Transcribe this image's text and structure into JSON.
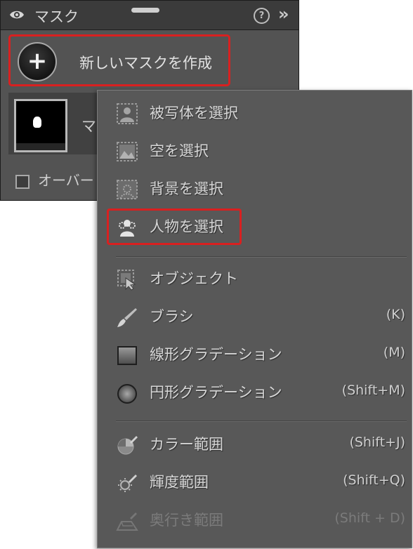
{
  "panel": {
    "title": "マスク",
    "header_icons": [
      "eye-icon",
      "grip-handle",
      "help-icon",
      "chevron-double-right-icon"
    ],
    "new_mask_label": "新しいマスクを作成",
    "new_mask_button_glyph": "+",
    "mask_item_name": "マ",
    "overlay_label": "オーバー",
    "help_glyph": "?",
    "chevron_glyph": "»"
  },
  "menu": {
    "items": [
      {
        "label": "被写体を選択",
        "shortcut": "",
        "icon": "select-subject-icon",
        "enabled": true
      },
      {
        "label": "空を選択",
        "shortcut": "",
        "icon": "select-sky-icon",
        "enabled": true
      },
      {
        "label": "背景を選択",
        "shortcut": "",
        "icon": "select-background-icon",
        "enabled": true
      },
      {
        "label": "人物を選択",
        "shortcut": "",
        "icon": "select-people-icon",
        "enabled": true
      },
      {
        "label": "オブジェクト",
        "shortcut": "",
        "icon": "object-select-icon",
        "enabled": true
      },
      {
        "label": "ブラシ",
        "shortcut": "(K)",
        "icon": "brush-icon",
        "enabled": true
      },
      {
        "label": "線形グラデーション",
        "shortcut": "(M)",
        "icon": "linear-gradient-icon",
        "enabled": true
      },
      {
        "label": "円形グラデーション",
        "shortcut": "(Shift+M)",
        "icon": "radial-gradient-icon",
        "enabled": true
      },
      {
        "label": "カラー範囲",
        "shortcut": "(Shift+J)",
        "icon": "color-range-icon",
        "enabled": true
      },
      {
        "label": "輝度範囲",
        "shortcut": "(Shift+Q)",
        "icon": "luminance-range-icon",
        "enabled": true
      },
      {
        "label": "奥行き範囲",
        "shortcut": "(Shift + D)",
        "icon": "depth-range-icon",
        "enabled": false
      }
    ]
  },
  "colors": {
    "highlight_border": "#d92020",
    "panel_bg": "#535353",
    "menu_bg": "#585858"
  }
}
